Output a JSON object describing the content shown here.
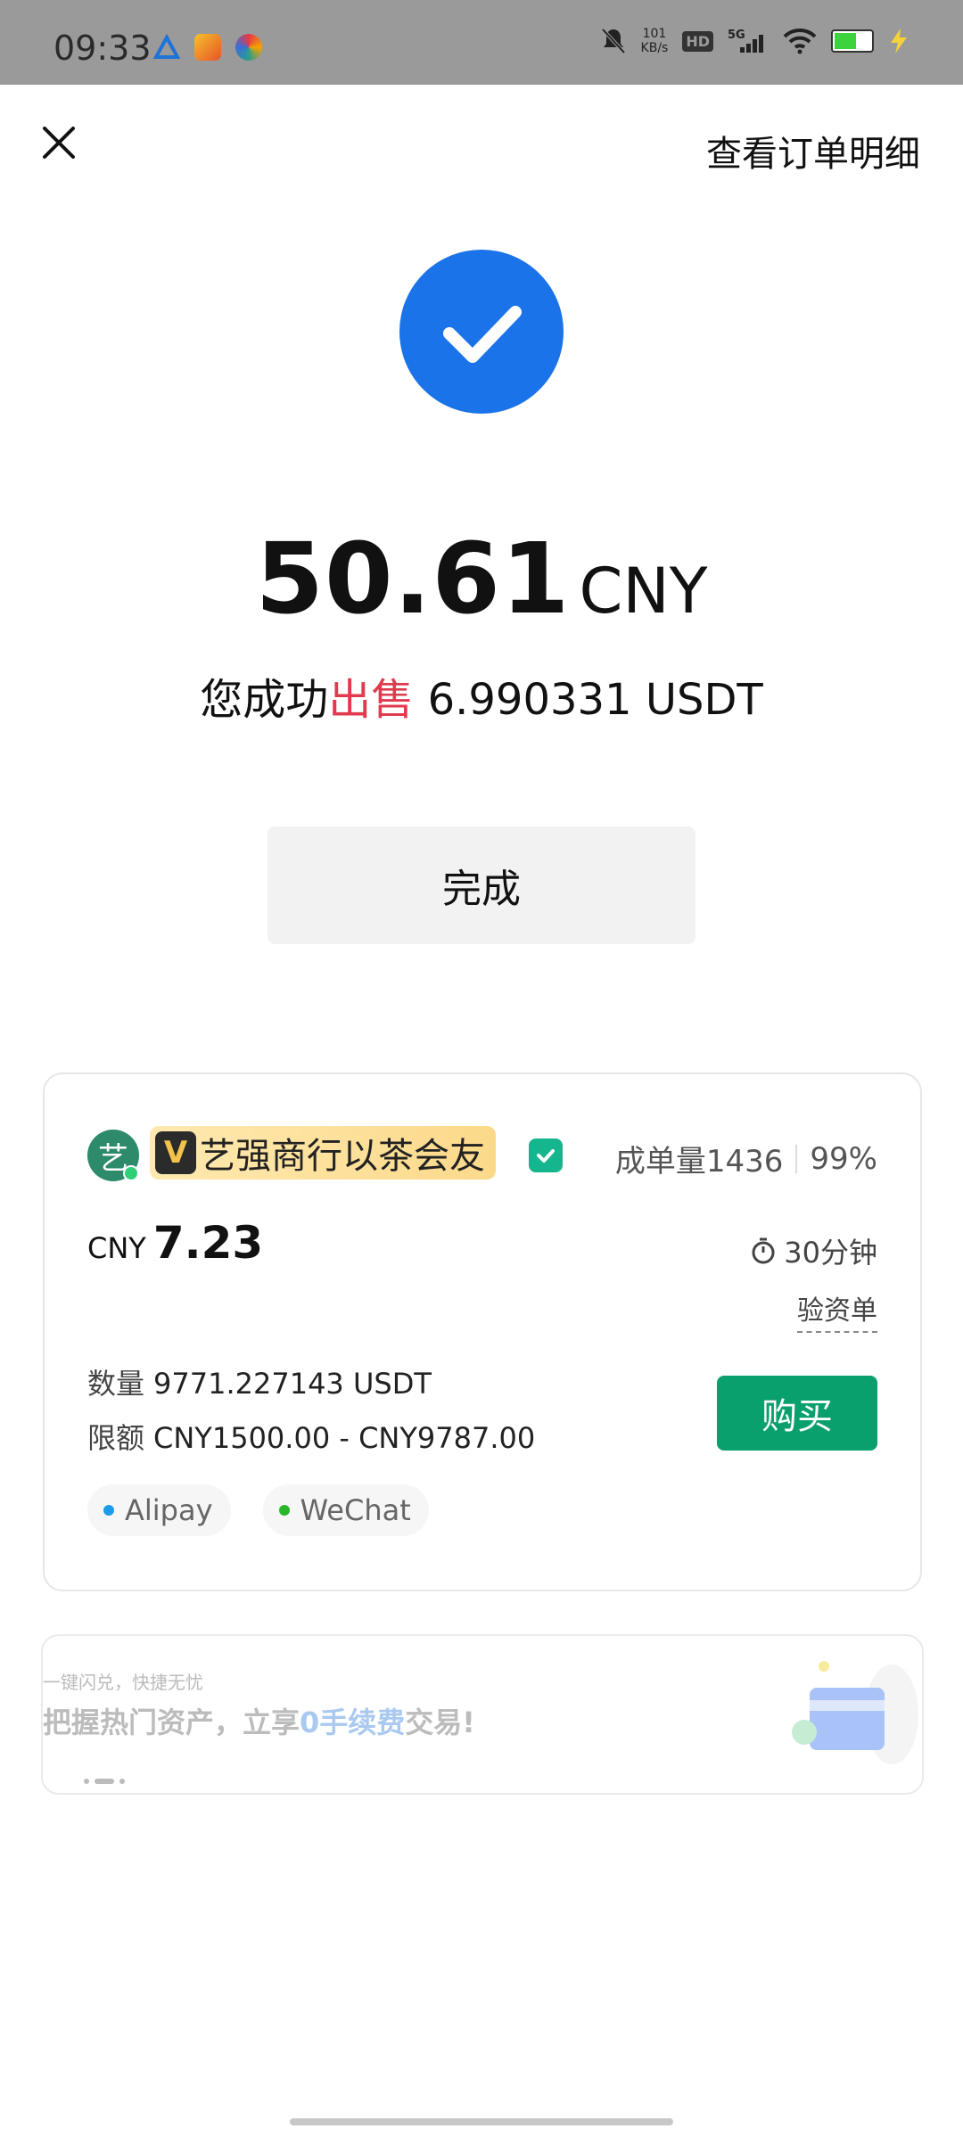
{
  "status_bar": {
    "time": "09:33",
    "net_speed_value": "101",
    "net_speed_unit": "KB/s",
    "hd_label": "HD",
    "network_label": "5G",
    "battery_level": 0.6
  },
  "header": {
    "view_order_details": "查看订单明细"
  },
  "result": {
    "amount": "50.61",
    "currency": "CNY",
    "sold_prefix": "您成功",
    "sold_action": "出售",
    "sold_amount": "6.990331 USDT",
    "done_label": "完成"
  },
  "ad": {
    "avatar_char": "艺",
    "v_badge": "V",
    "merchant_name": "艺强商行以茶会友",
    "orders_label": "成单量1436",
    "completion_rate": "99%",
    "price_currency": "CNY",
    "price_value": "7.23",
    "payment_time": "30分钟",
    "verify_label": "验资单",
    "quantity_label": "数量",
    "quantity_value": "9771.227143 USDT",
    "limit_label": "限额",
    "limit_value": "CNY1500.00 - CNY9787.00",
    "buy_label": "购买",
    "payment_methods": [
      {
        "name": "Alipay",
        "color": "#1e9be6"
      },
      {
        "name": "WeChat",
        "color": "#2ab52a"
      }
    ]
  },
  "banner": {
    "subtitle": "一键闪兑，快捷无忧",
    "title_prefix": "把握热门资产，立享",
    "title_highlight": "0手续费",
    "title_suffix": "交易!"
  },
  "colors": {
    "accent_blue": "#1a73e8",
    "sell_red": "#e03a4e",
    "buy_green": "#0aa06e"
  }
}
